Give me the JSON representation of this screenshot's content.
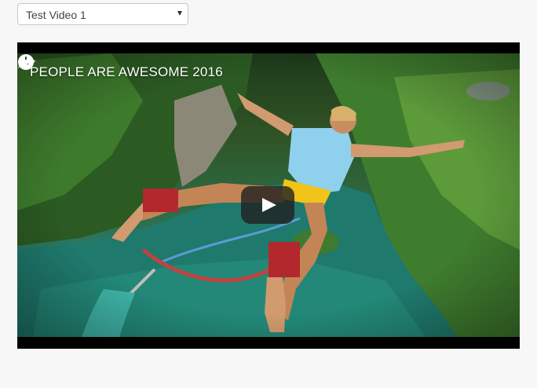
{
  "video_select": {
    "selected_label": "Test Video 1"
  },
  "player": {
    "title": "PEOPLE ARE AWESOME 2016",
    "icons": [
      "clock-icon",
      "share-icon",
      "play-icon"
    ],
    "colors": {
      "frame": "#000000",
      "play_button_bg": "#212121",
      "title_text": "#ffffff"
    }
  }
}
